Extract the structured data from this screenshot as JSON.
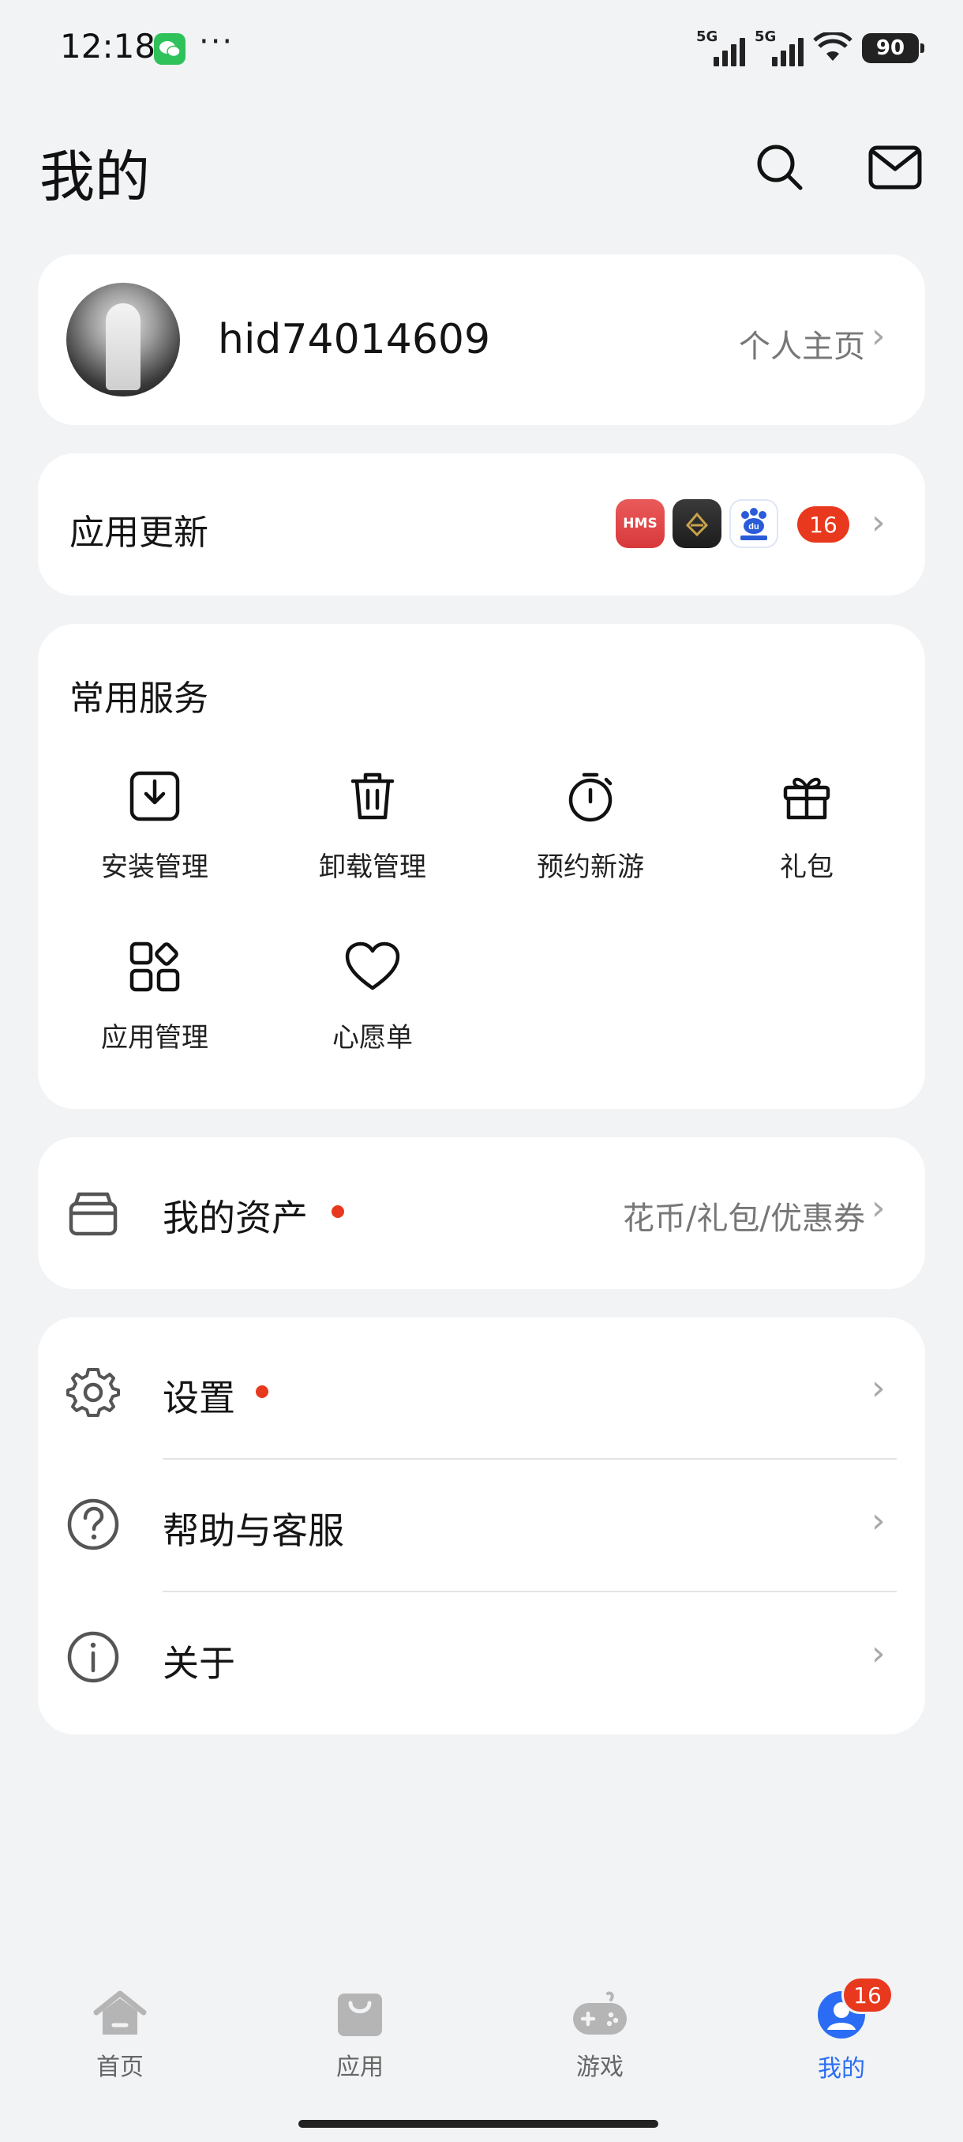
{
  "status_bar": {
    "time": "12:18",
    "more": "···",
    "signal_1": "5G",
    "signal_2": "5G",
    "battery": "90"
  },
  "header": {
    "title": "我的",
    "search_icon": "search-icon",
    "message_icon": "mail-icon"
  },
  "profile": {
    "username": "hid74014609",
    "homepage_link": "个人主页"
  },
  "app_update": {
    "title": "应用更新",
    "apps": [
      "HMS",
      "app-2",
      "baidu"
    ],
    "hms_label": "HMS",
    "baidu_label": "du",
    "count": "16"
  },
  "services": {
    "title": "常用服务",
    "items": [
      {
        "label": "安装管理",
        "icon": "install-icon"
      },
      {
        "label": "卸载管理",
        "icon": "trash-icon"
      },
      {
        "label": "预约新游",
        "icon": "stopwatch-icon"
      },
      {
        "label": "礼包",
        "icon": "gift-icon"
      },
      {
        "label": "应用管理",
        "icon": "apps-grid-icon"
      },
      {
        "label": "心愿单",
        "icon": "heart-icon"
      }
    ]
  },
  "assets": {
    "title": "我的资产",
    "detail": "花币/礼包/优惠券",
    "has_dot": true
  },
  "menu": {
    "settings": "设置",
    "help": "帮助与客服",
    "about": "关于"
  },
  "bottom_nav": {
    "items": [
      {
        "label": "首页",
        "icon": "home-icon"
      },
      {
        "label": "应用",
        "icon": "bag-icon"
      },
      {
        "label": "游戏",
        "icon": "gamepad-icon"
      },
      {
        "label": "我的",
        "icon": "profile-icon"
      }
    ],
    "active": "我的",
    "profile_badge": "16"
  },
  "colors": {
    "background": "#f1f3f5",
    "accent_blue": "#2a6df4",
    "badge_red": "#e8381d"
  }
}
